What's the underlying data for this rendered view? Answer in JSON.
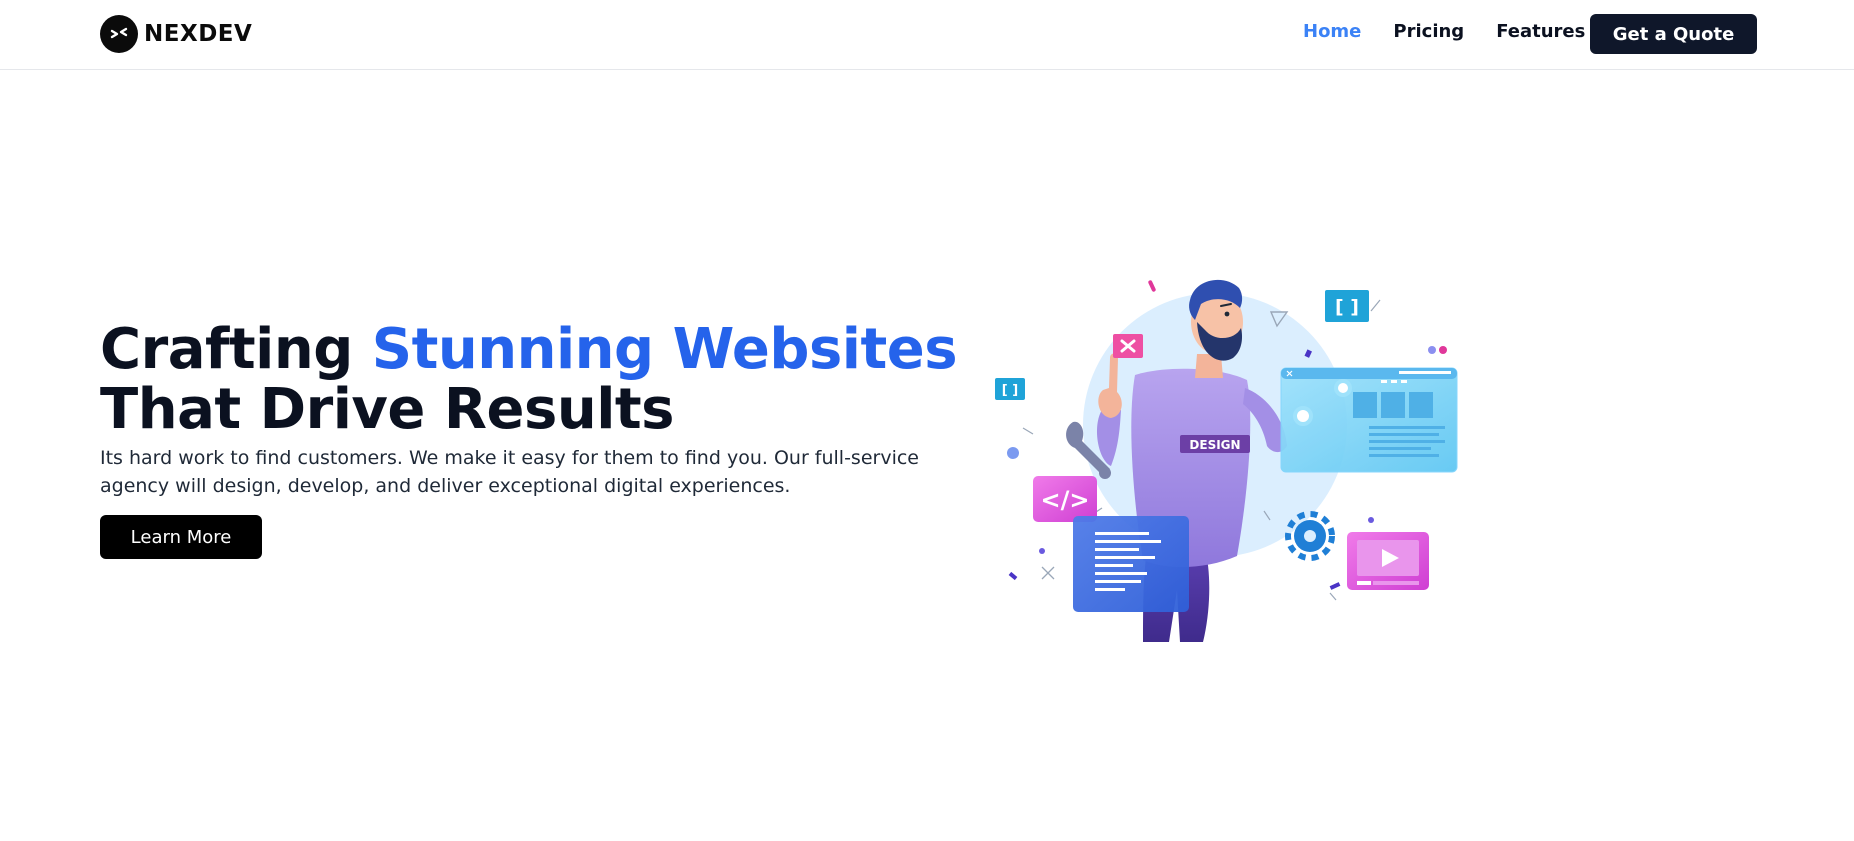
{
  "brand": {
    "name": "NEXDEV",
    "logo_icon": "arrows-in-icon"
  },
  "nav": {
    "links": [
      {
        "label": "Home",
        "active": true
      },
      {
        "label": "Pricing",
        "active": false
      },
      {
        "label": "Features",
        "active": false
      }
    ],
    "cta_label": "Get a Quote"
  },
  "hero": {
    "title_part1": "Crafting ",
    "title_accent": "Stunning Websites",
    "title_part2": "That Drive Results",
    "subtitle": "Its hard work to find customers. We make it easy for them to find you. Our full-service agency will design, develop, and deliver exceptional digital experiences.",
    "button_label": "Learn More",
    "illustration": {
      "shirt_text": "DESIGN",
      "code_tag": "</>",
      "bracket_glyph": "[ ]"
    }
  },
  "colors": {
    "accent": "#2563eb",
    "nav_active": "#3b82f6",
    "dark": "#0f172a",
    "magenta": "#e04ad8",
    "illustration_circle": "#dbeefe"
  }
}
